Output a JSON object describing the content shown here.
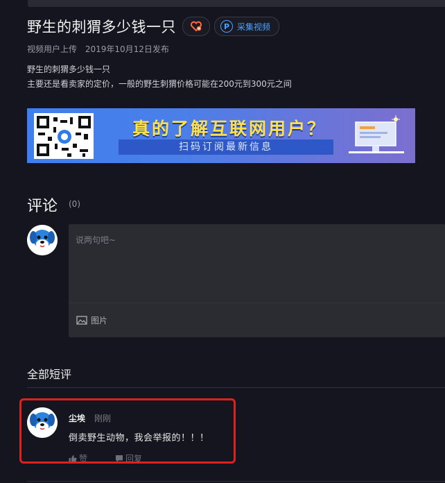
{
  "video": {
    "title": "野生的刺猬多少钱一只",
    "collect_label": "采集视频",
    "uploader": "视频用户上传",
    "date": "2019年10月12日发布",
    "desc_line1": "野生的刺猬多少钱一只",
    "desc_line2": "主要还是看卖家的定价，一般的野生刺猬价格可能在200元到300元之间"
  },
  "banner": {
    "headline": "真的了解互联网用户？",
    "subline": "扫码订阅最新信息"
  },
  "comments": {
    "title": "评论",
    "count": "(0)",
    "placeholder": "说两句吧~",
    "image_label": "图片",
    "all_title": "全部短评",
    "items": [
      {
        "user": "尘埃",
        "time": "刚刚",
        "text": "倒卖野生动物，我会举报的！！！",
        "like_label": "赞",
        "reply_label": "回复"
      }
    ]
  },
  "colors": {
    "background": "#15151f",
    "accent_blue": "#4aa3ff",
    "highlight_red": "#e0211b"
  },
  "icons": [
    "heart-plus-icon",
    "p-badge-icon",
    "image-icon",
    "thumb-up-icon",
    "chat-bubble-icon",
    "avatar-dog-icon"
  ]
}
